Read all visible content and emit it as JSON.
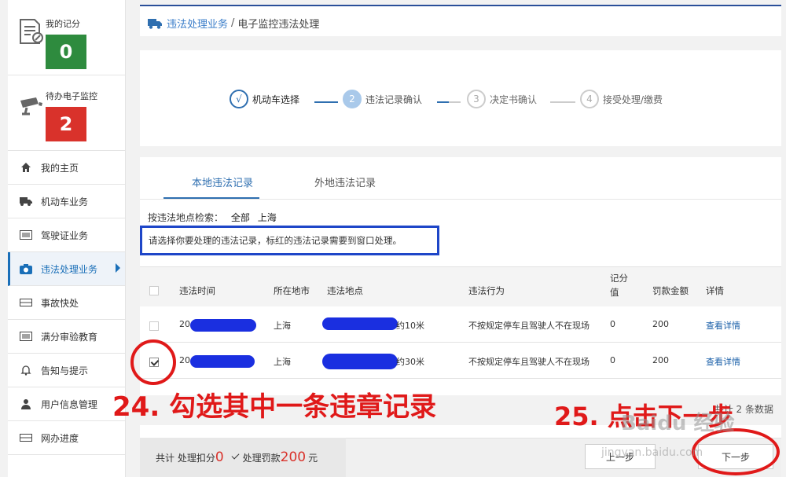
{
  "sidebar": {
    "stats": [
      {
        "label": "我的记分",
        "value": "0",
        "color": "#2e8b3e"
      },
      {
        "label": "待办电子监控",
        "value": "2",
        "color": "#d9322b"
      }
    ],
    "items": [
      {
        "label": "我的主页",
        "icon": "home-icon"
      },
      {
        "label": "机动车业务",
        "icon": "truck-icon"
      },
      {
        "label": "驾驶证业务",
        "icon": "license-card-icon"
      },
      {
        "label": "违法处理业务",
        "icon": "camera-icon"
      },
      {
        "label": "事故快处",
        "icon": "accident-icon"
      },
      {
        "label": "满分审验教育",
        "icon": "list-icon"
      },
      {
        "label": "告知与提示",
        "icon": "bell-icon"
      },
      {
        "label": "用户信息管理",
        "icon": "user-icon"
      },
      {
        "label": "网办进度",
        "icon": "progress-icon"
      }
    ]
  },
  "breadcrumb": {
    "link": "违法处理业务",
    "sep": "/",
    "current": "电子监控违法处理"
  },
  "steps": [
    {
      "num": "√",
      "label": "机动车选择"
    },
    {
      "num": "2",
      "label": "违法记录确认"
    },
    {
      "num": "3",
      "label": "决定书确认"
    },
    {
      "num": "4",
      "label": "接受处理/缴费"
    }
  ],
  "tabs": [
    "本地违法记录",
    "外地违法记录"
  ],
  "filter": {
    "label": "按违法地点检索：",
    "options": [
      "全部",
      "上海"
    ]
  },
  "notice": "请选择你要处理的违法记录，标红的违法记录需要到窗口处理。",
  "table": {
    "headers": {
      "time": "违法时间",
      "city": "所在地市",
      "place": "违法地点",
      "action": "违法行为",
      "points": "记分值",
      "points_a": "记分",
      "points_b": "值",
      "fine": "罚款金额",
      "detail": "详情"
    },
    "rows": [
      {
        "time": "20",
        "city": "上海",
        "place": "约10米",
        "action": "不按规定停车且驾驶人不在现场",
        "points": "0",
        "fine": "200",
        "detail": "查看详情",
        "checked": false
      },
      {
        "time": "20",
        "city": "上海",
        "place": "约30米",
        "action": "不按规定停车且驾驶人不在现场",
        "points": "0",
        "fine": "200",
        "detail": "查看详情",
        "checked": true
      }
    ]
  },
  "footer_count": "共计 2 条数据",
  "summary": {
    "prefix": "共计 处理扣分",
    "points": "0",
    "fine_label": "处理罚款",
    "fine": "200",
    "unit": "元"
  },
  "buttons": {
    "prev": "上一步",
    "next": "下一步"
  },
  "annotations": {
    "a24": "24. 勾选其中一条违章记录",
    "a25": "25. 点击下一步"
  },
  "watermark": {
    "line1": "Baidu 经验",
    "line2": "jingyan.baidu.com"
  }
}
